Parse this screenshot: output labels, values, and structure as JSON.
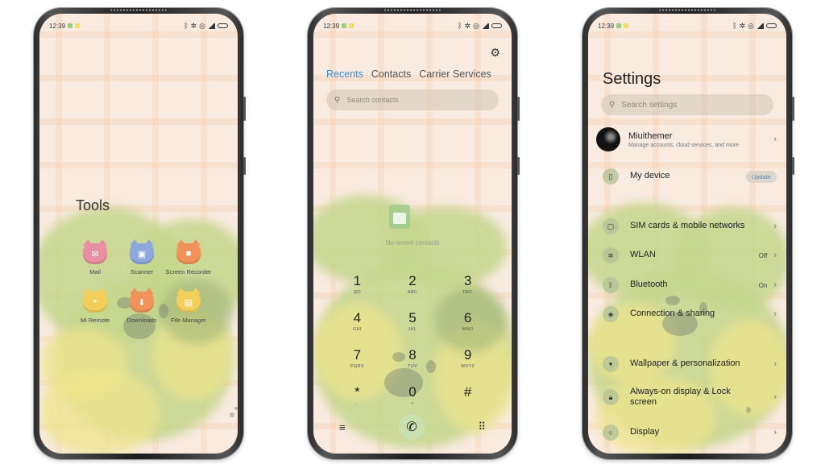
{
  "status_bar": {
    "time": "12:39"
  },
  "phone1": {
    "folder_title": "Tools",
    "apps": [
      {
        "label": "Mail",
        "color": "#e98fa3",
        "glyph": "✉"
      },
      {
        "label": "Scanner",
        "color": "#8fa8dc",
        "glyph": "▣"
      },
      {
        "label": "Screen Recorder",
        "color": "#f0935a",
        "glyph": "■"
      },
      {
        "label": "Mi Remote",
        "color": "#f2cf5a",
        "glyph": "◓"
      },
      {
        "label": "Downloads",
        "color": "#f0935a",
        "glyph": "⬇"
      },
      {
        "label": "File Manager",
        "color": "#f2cf5a",
        "glyph": "▤"
      }
    ]
  },
  "phone2": {
    "tabs": [
      "Recents",
      "Contacts",
      "Carrier Services"
    ],
    "active_tab": "Recents",
    "search_placeholder": "Search contacts",
    "empty_text": "No recent contacts",
    "keys": [
      {
        "num": "1",
        "letters": "QO"
      },
      {
        "num": "2",
        "letters": "ABC"
      },
      {
        "num": "3",
        "letters": "DEF"
      },
      {
        "num": "4",
        "letters": "GHI"
      },
      {
        "num": "5",
        "letters": "JKL"
      },
      {
        "num": "6",
        "letters": "MNO"
      },
      {
        "num": "7",
        "letters": "PQRS"
      },
      {
        "num": "8",
        "letters": "TUV"
      },
      {
        "num": "9",
        "letters": "WXYZ"
      },
      {
        "num": "*",
        "letters": ","
      },
      {
        "num": "0",
        "letters": "+"
      },
      {
        "num": "#",
        "letters": ""
      }
    ]
  },
  "phone3": {
    "title": "Settings",
    "search_placeholder": "Search settings",
    "account": {
      "name": "Miuithemer",
      "subtitle": "Manage accounts, cloud services, and more"
    },
    "my_device": {
      "label": "My device",
      "badge": "Update"
    },
    "items": [
      {
        "label": "SIM cards & mobile networks",
        "value": "",
        "glyph": "▢"
      },
      {
        "label": "WLAN",
        "value": "Off",
        "glyph": "≋"
      },
      {
        "label": "Bluetooth",
        "value": "On",
        "glyph": "ᛒ"
      },
      {
        "label": "Connection & sharing",
        "value": "",
        "glyph": "◈"
      },
      {
        "label": "Wallpaper & personalization",
        "value": "",
        "glyph": "▾"
      },
      {
        "label": "Always-on display & Lock screen",
        "value": "",
        "glyph": "🔒︎"
      },
      {
        "label": "Display",
        "value": "",
        "glyph": "○"
      }
    ]
  },
  "colors": {
    "accent": "#3d8fd8",
    "background": "#f9ebe0"
  }
}
